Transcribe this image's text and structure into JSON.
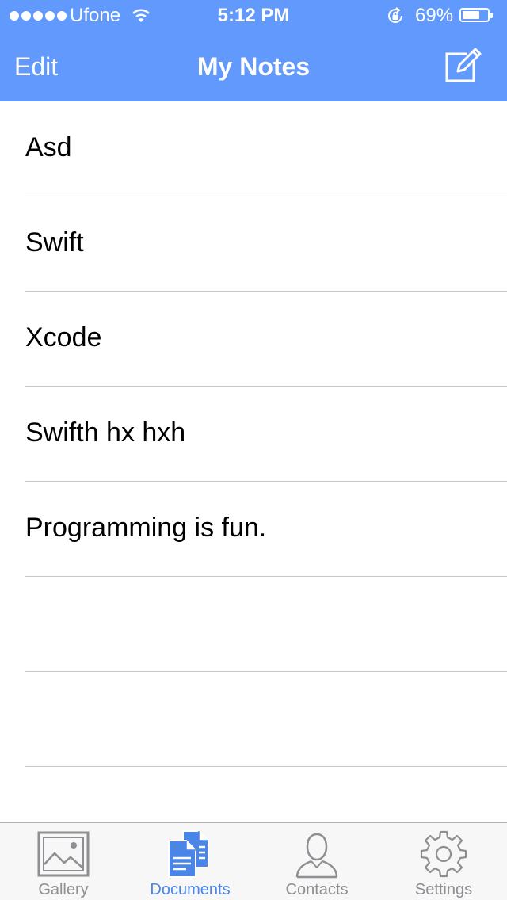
{
  "status_bar": {
    "carrier": "Ufone",
    "time": "5:12 PM",
    "battery_percent": "69%",
    "battery_level": 0.69
  },
  "nav_bar": {
    "edit_label": "Edit",
    "title": "My Notes",
    "compose_icon": "compose-icon"
  },
  "notes": [
    {
      "title": "Asd"
    },
    {
      "title": "Swift"
    },
    {
      "title": "Xcode"
    },
    {
      "title": "Swifth hx hxh"
    },
    {
      "title": "Programming is fun."
    },
    {
      "title": ""
    },
    {
      "title": ""
    }
  ],
  "tab_bar": {
    "tabs": [
      {
        "label": "Gallery",
        "icon": "gallery-icon",
        "active": false
      },
      {
        "label": "Documents",
        "icon": "documents-icon",
        "active": true
      },
      {
        "label": "Contacts",
        "icon": "contacts-icon",
        "active": false
      },
      {
        "label": "Settings",
        "icon": "settings-icon",
        "active": false
      }
    ]
  },
  "colors": {
    "nav_background": "#6199fd",
    "tab_active": "#4a86e8",
    "tab_inactive": "#8e8e93",
    "separator": "#c8c7cc"
  }
}
